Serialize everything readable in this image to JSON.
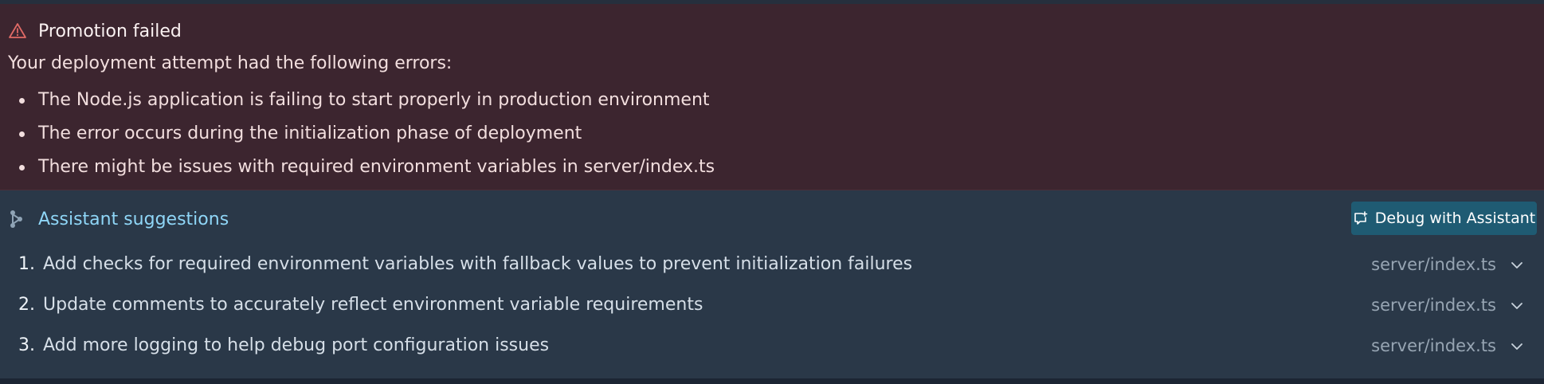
{
  "error": {
    "title": "Promotion failed",
    "intro": "Your deployment attempt had the following errors:",
    "items": [
      "The Node.js application is failing to start properly in production environment",
      "The error occurs during the initialization phase of deployment",
      "There might be issues with required environment variables in server/index.ts"
    ],
    "icon": "warning-triangle-icon",
    "color": "#e06a66"
  },
  "suggestions": {
    "title": "Assistant suggestions",
    "icon": "assistant-icon",
    "accent": "#8fd6f7",
    "debug_button": "Debug with Assistant",
    "items": [
      {
        "num": "1.",
        "text": "Add checks for required environment variables with fallback values to prevent initialization failures",
        "file": "server/index.ts"
      },
      {
        "num": "2.",
        "text": "Update comments to accurately reflect environment variable requirements",
        "file": "server/index.ts"
      },
      {
        "num": "3.",
        "text": "Add more logging to help debug port configuration issues",
        "file": "server/index.ts"
      }
    ]
  }
}
